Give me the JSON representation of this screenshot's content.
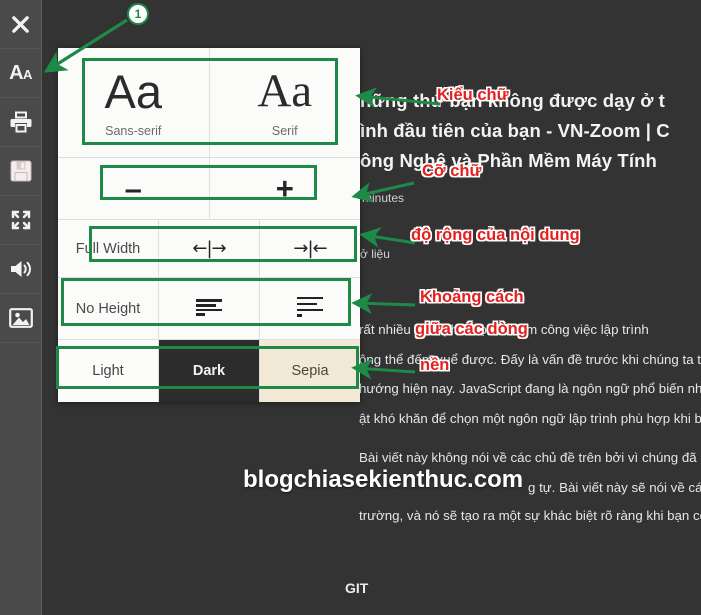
{
  "toolbar": {
    "items": [
      {
        "name": "close-icon",
        "label": "Close"
      },
      {
        "name": "font-settings-icon",
        "label": "Aa"
      },
      {
        "name": "print-icon",
        "label": "Print"
      },
      {
        "name": "save-icon",
        "label": "Save"
      },
      {
        "name": "fullscreen-icon",
        "label": "Fullscreen"
      },
      {
        "name": "speaker-icon",
        "label": "Read aloud"
      },
      {
        "name": "image-icon",
        "label": "Images"
      }
    ]
  },
  "panel": {
    "font_family": {
      "sans": {
        "sample": "Aa",
        "caption": "Sans-serif"
      },
      "serif": {
        "sample": "Aa",
        "caption": "Serif"
      }
    },
    "font_size": {
      "decrease": "–",
      "increase": "+"
    },
    "width": {
      "label": "Full Width",
      "expand": "←|→",
      "narrow": "→|←"
    },
    "line_height": {
      "label": "No Height",
      "tight": "line-height-tight-icon",
      "loose": "line-height-loose-icon"
    },
    "theme": {
      "light": "Light",
      "dark": "Dark",
      "sepia": "Sepia",
      "selected": "Dark"
    }
  },
  "annotations": {
    "marker_number": "1",
    "font_style": "Kiểu chữ",
    "font_size": "Cỡ chữ",
    "content_width": "độ rộng của nội dung",
    "line_spacing_1": "Khoảng cách",
    "line_spacing_2": "giữa các dòng",
    "background": "nền"
  },
  "article": {
    "title_line1": "hững thứ bạn không được dạy ở t",
    "title_line2": "ình đầu tiên của bạn - VN-Zoom | C",
    "title_line3": "ông Nghệ và Phần Mềm Máy Tính",
    "meta": "minutes",
    "meta2": "ở liệu",
    "body_line1": "rất nhiều điều phải học để làm công việc lập trình",
    "body_line2": "ông thể đếm xuể được. Đấy là vấn đề trước khi chúng ta th",
    "body_line3": "hướng hiện nay. JavaScript đang là ngôn ngữ phổ biến nh",
    "body_line4": "ật khó khăn để chọn một ngôn ngữ lập trình phù hợp khi bạ",
    "body_line5": "Bài viết này không nói về các chủ đề trên bởi vì chúng đã đượ",
    "body_line6": "g tự. Bài viết này sẽ nói về các",
    "body_line7": "trường, và nó sẽ tạo ra một sự khác biệt rõ ràng khi bạn có m",
    "footer": "GIT"
  },
  "watermark": "blogchiasekienthuc.com",
  "colors": {
    "accent_green": "#1e8a47",
    "annotation_red": "#e32121",
    "panel_bg": "#fbfbfa",
    "page_bg": "#333333",
    "toolbar_bg": "#4a4a4a",
    "sepia_bg": "#f1e8d6"
  }
}
